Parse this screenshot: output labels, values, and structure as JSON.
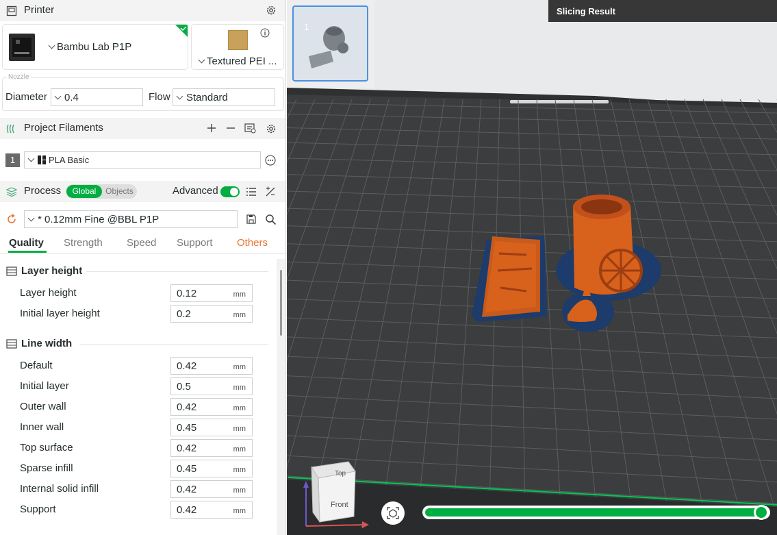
{
  "printer": {
    "title": "Printer",
    "name": "Bambu Lab P1P",
    "plate": "Textured PEI ...",
    "nozzle_label": "Nozzle",
    "diameter_label": "Diameter",
    "diameter_value": "0.4",
    "flow_label": "Flow",
    "flow_value": "Standard"
  },
  "filaments": {
    "title": "Project Filaments",
    "items": [
      {
        "index": "1",
        "name": "PLA Basic"
      }
    ]
  },
  "process": {
    "title": "Process",
    "toggle_global": "Global",
    "toggle_objects": "Objects",
    "advanced_label": "Advanced",
    "advanced_on": true,
    "preset": "* 0.12mm Fine @BBL P1P"
  },
  "tabs": [
    {
      "label": "Quality",
      "active": true
    },
    {
      "label": "Strength",
      "active": false
    },
    {
      "label": "Speed",
      "active": false
    },
    {
      "label": "Support",
      "active": false
    },
    {
      "label": "Others",
      "active": false
    }
  ],
  "settings": {
    "layer_height_group": "Layer height",
    "layer_rows": [
      {
        "label": "Layer height",
        "value": "0.12",
        "unit": "mm"
      },
      {
        "label": "Initial layer height",
        "value": "0.2",
        "unit": "mm"
      }
    ],
    "line_width_group": "Line width",
    "line_rows": [
      {
        "label": "Default",
        "value": "0.42",
        "unit": "mm"
      },
      {
        "label": "Initial layer",
        "value": "0.5",
        "unit": "mm"
      },
      {
        "label": "Outer wall",
        "value": "0.42",
        "unit": "mm"
      },
      {
        "label": "Inner wall",
        "value": "0.45",
        "unit": "mm"
      },
      {
        "label": "Top surface",
        "value": "0.42",
        "unit": "mm"
      },
      {
        "label": "Sparse infill",
        "value": "0.45",
        "unit": "mm"
      },
      {
        "label": "Internal solid infill",
        "value": "0.42",
        "unit": "mm"
      },
      {
        "label": "Support",
        "value": "0.42",
        "unit": "mm"
      }
    ]
  },
  "viewport": {
    "plate_thumbnail_number": "1",
    "slicing_result_title": "Slicing Result",
    "view_cube_top": "Top",
    "view_cube_front": "Front",
    "axis_x": "x",
    "layer_slider_progress": 1.0
  },
  "colors": {
    "accent": "#00ae42",
    "others_tab": "#e8742e",
    "model_orange": "#d8611c",
    "support_blue": "#1d3b6b",
    "bed": "#3c3d3f",
    "slicing_banner": "#373737"
  },
  "icons": {
    "printer_header": "printer-icon",
    "printer_settings": "gear-icon",
    "filaments_header": "filament-icon",
    "add_filament": "plus-icon",
    "remove_filament": "minus-icon",
    "filament_sync": "sync-ams-icon",
    "filament_settings": "gear-icon",
    "process_header": "layers-icon",
    "preset_reset": "reset-icon",
    "preset_save": "save-icon",
    "preset_search": "search-icon",
    "list_view": "list-icon",
    "compare": "compare-icon"
  }
}
